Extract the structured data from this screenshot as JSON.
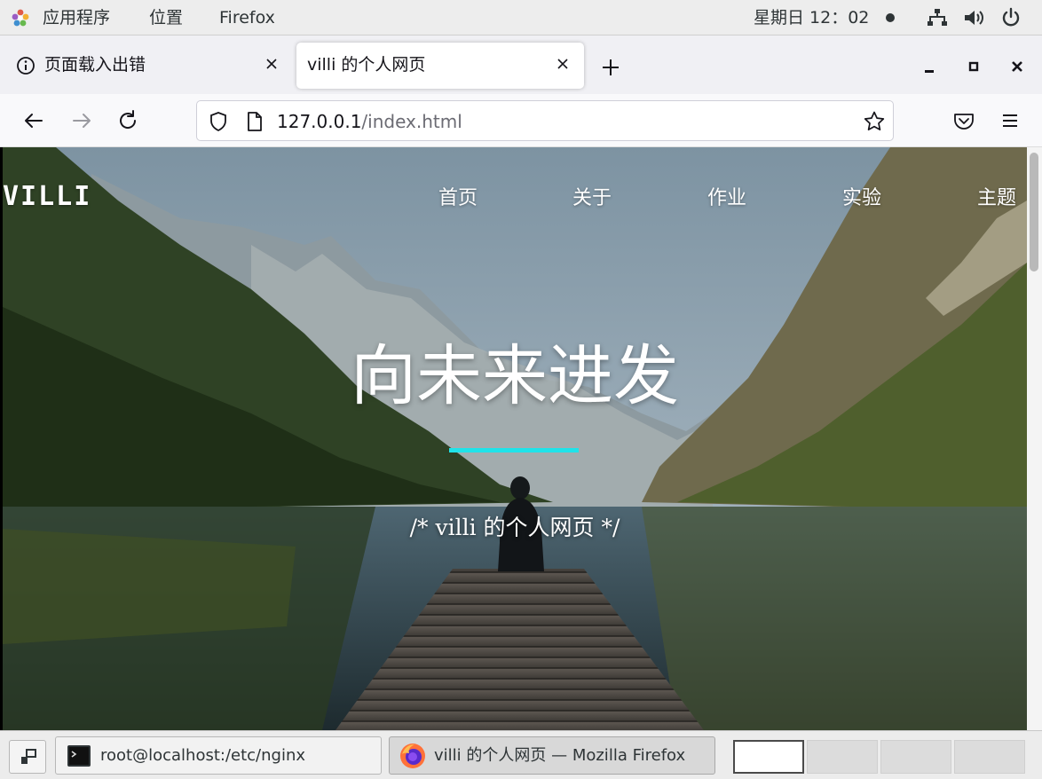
{
  "topbar": {
    "apps_menu": "应用程序",
    "places_menu": "位置",
    "active_app": "Firefox",
    "clock": "星期日 12：02",
    "icons": [
      "network-icon",
      "volume-icon",
      "power-icon"
    ]
  },
  "browser": {
    "tabs": [
      {
        "label": "页面载入出错",
        "active": false,
        "icon": "info-icon"
      },
      {
        "label": "villi 的个人网页",
        "active": true
      }
    ],
    "url": {
      "host": "127.0.0.1",
      "path": "/index.html"
    },
    "toolbar_icons": [
      "back-icon",
      "forward-icon",
      "reload-icon",
      "shield-icon",
      "page-icon",
      "bookmark-star-icon",
      "pocket-icon",
      "menu-icon"
    ]
  },
  "page": {
    "brand": "VILLI",
    "nav": [
      "首页",
      "关于",
      "作业",
      "实验",
      "主题"
    ],
    "hero_title": "向未来进发",
    "hero_subtitle": "/* villi 的个人网页 */",
    "accent_color": "#1fe3e9"
  },
  "taskbar": {
    "tasks": [
      {
        "label": "root@localhost:/etc/nginx",
        "icon": "terminal-icon"
      },
      {
        "label": "villi 的个人网页 — Mozilla Firefox",
        "icon": "firefox-icon",
        "active": true
      }
    ],
    "workspaces": 4,
    "active_workspace": 1
  }
}
